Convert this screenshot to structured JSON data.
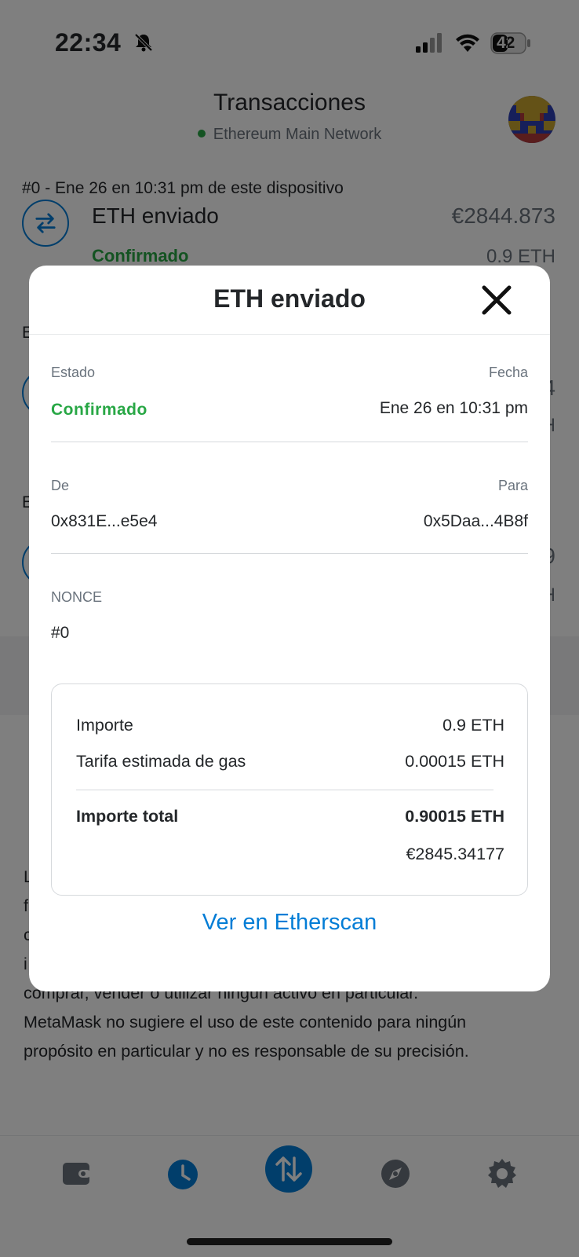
{
  "status_bar": {
    "time": "22:34",
    "battery": "42"
  },
  "header": {
    "title": "Transacciones",
    "network": "Ethereum Main Network"
  },
  "transaction": {
    "date": "#0 - Ene 26 en 10:31 pm de este dispositivo",
    "title": "ETH enviado",
    "fiat": "€2844.873",
    "status": "Confirmado",
    "amount": "0.9 ETH"
  },
  "background_partial": {
    "letter_e": "E",
    "right_digit_1": "4",
    "right_unit_1": "H",
    "right_digit_2": "9",
    "right_unit_2": "H"
  },
  "disclaimer": {
    "lines": [
      "L",
      "f",
      "c",
      "i",
      "comprar, vender o utilizar ningún activo en particular.",
      "MetaMask no sugiere el uso de este contenido para ningún",
      "propósito en particular y no es responsable de su precisión."
    ]
  },
  "modal": {
    "title": "ETH enviado",
    "status_label": "Estado",
    "status_value": "Confirmado",
    "date_label": "Fecha",
    "date_value": "Ene 26 en 10:31 pm",
    "from_label": "De",
    "from_value": "0x831E...e5e4",
    "to_label": "Para",
    "to_value": "0x5Daa...4B8f",
    "nonce_label": "NONCE",
    "nonce_value": "#0",
    "summary": {
      "amount_label": "Importe",
      "amount_value": "0.9 ETH",
      "gas_label": "Tarifa estimada de gas",
      "gas_value": "0.00015 ETH",
      "total_label": "Importe total",
      "total_value": "0.90015 ETH",
      "total_fiat": "€2845.34177"
    },
    "etherscan_link": "Ver en Etherscan"
  },
  "colors": {
    "accent": "#037dd6",
    "success": "#28a745",
    "text": "#24272a",
    "muted": "#6a737d"
  },
  "icons": {
    "close": "close-icon",
    "transfer": "transfer-icon",
    "wallet": "wallet-icon",
    "activity": "clock-icon",
    "swap": "swap-icon",
    "browser": "compass-icon",
    "settings": "gear-icon"
  }
}
